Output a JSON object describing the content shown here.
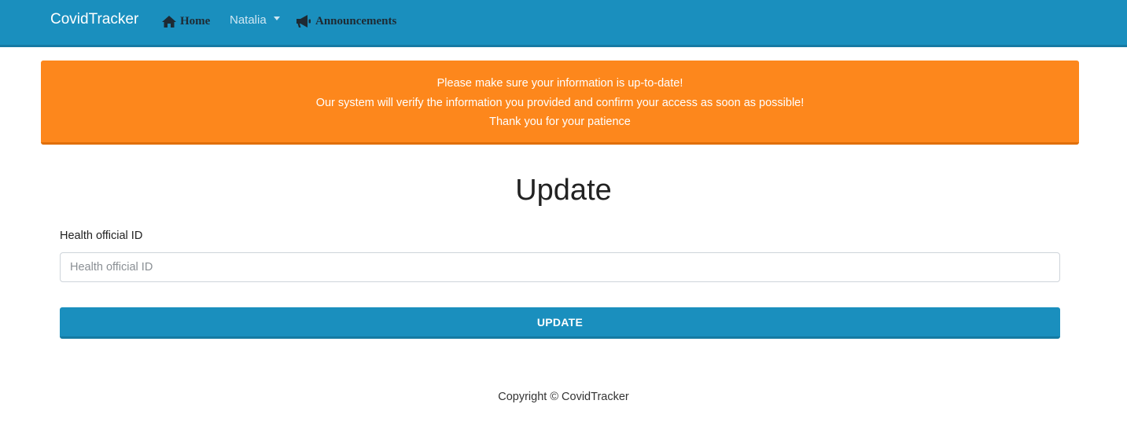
{
  "navbar": {
    "brand": "CovidTracker",
    "items": [
      {
        "label": "Home",
        "icon": "home-icon"
      },
      {
        "label": "Natalia",
        "icon": "chevron-down-icon"
      },
      {
        "label": "Announcements",
        "icon": "megaphone-icon"
      }
    ]
  },
  "alert": {
    "lines": [
      "Please make sure your information is up-to-date!",
      "Our system will verify the information you provided and confirm your access as soon as possible!",
      "Thank you for your patience"
    ]
  },
  "form": {
    "title": "Update",
    "field_label": "Health official ID",
    "field_placeholder": "Health official ID",
    "field_value": "",
    "submit_label": "UPDATE"
  },
  "footer": {
    "copyright": "Copyright © CovidTracker"
  },
  "colors": {
    "navbar": "#1a8fbe",
    "alert": "#fd871c",
    "button": "#1a8fbe"
  }
}
